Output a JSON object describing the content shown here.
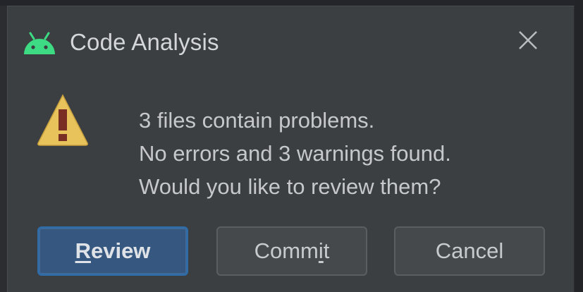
{
  "dialog": {
    "title": "Code Analysis",
    "icons": {
      "app": "android-icon",
      "close": "close-icon",
      "warning": "warning-icon"
    },
    "message": {
      "line1": "3 files contain problems.",
      "line2": "No errors and 3 warnings found.",
      "line3": "Would you like to review them?"
    },
    "buttons": {
      "review": {
        "mnemonic": "R",
        "rest": "eview"
      },
      "commit": {
        "before": "Comm",
        "mnemonic": "i",
        "after": "t"
      },
      "cancel": {
        "label": "Cancel"
      }
    }
  },
  "colors": {
    "background": "#3c3f41",
    "android_green": "#3ddc84",
    "warning_yellow": "#e8c25a",
    "primary_button": "#365880",
    "primary_border": "#2f6ca8"
  }
}
